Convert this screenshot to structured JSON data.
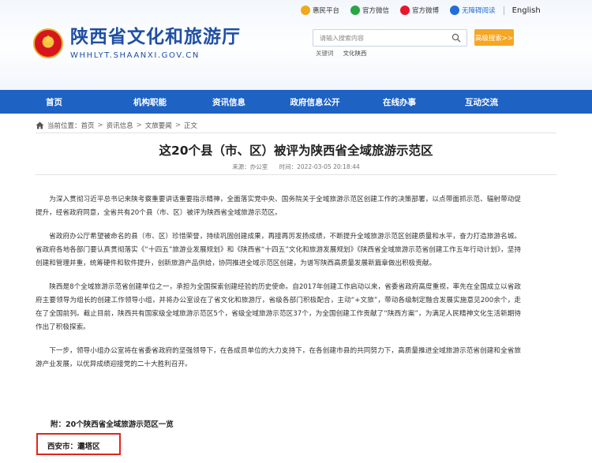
{
  "site": {
    "title": "陕西省文化和旅游厅",
    "domain": "WHHLYT.SHAANXI.GOV.CN"
  },
  "toplinks": [
    {
      "label": "惠民平台",
      "icon": "people-icon"
    },
    {
      "label": "官方微信",
      "icon": "wechat-icon"
    },
    {
      "label": "官方微博",
      "icon": "weibo-icon"
    },
    {
      "label": "无障碍阅读",
      "icon": "accessibility-icon"
    }
  ],
  "english_label": "English",
  "search": {
    "placeholder": "请输入搜索内容",
    "advanced_label": "高级搜索>>",
    "hot_label": "关键词",
    "hot_keyword": "文化陕西"
  },
  "nav": [
    "首页",
    "机构职能",
    "资讯信息",
    "政府信息公开",
    "在线办事",
    "互动交流"
  ],
  "breadcrumb": {
    "prefix": "当前位置：",
    "items": [
      "首页",
      "资讯信息",
      "文旅要闻",
      "正文"
    ]
  },
  "article": {
    "title": "这20个县（市、区）被评为陕西省全域旅游示范区",
    "source": "来源：办公室",
    "time": "时间：2022-03-05 20:18:44",
    "paragraphs": [
      "为深入贯彻习近平总书记来陕考察重要讲话重要指示精神，全面落实党中央、国务院关于全域旅游示范区创建工作的决策部署，以点带面抓示范、辐射带动促提升，经省政府同意，全省共有20个县（市、区）被评为陕西省全域旅游示范区。",
      "省政府办公厅希望被命名的县（市、区）珍惜荣誉，持续巩固创建成果，再接再厉发扬成绩，不断提升全域旅游示范区创建质量和水平，奋力打造旅游名城。省政府各地各部门要认真贯彻落实《“十四五”旅游业发展规划》和《陕西省“十四五”文化和旅游发展规划》《陕西省全域旅游示范省创建工作五年行动计划》，坚持创建和管理并重，统筹硬件和软件提升，创新旅游产品供给，协同推进全域示范区创建，为谱写陕西高质量发展新篇章做出积极贡献。",
      "陕西是8个全域旅游示范省创建单位之一，承担为全国探索创建经验的历史使命。自2017年创建工作启动以来，省委省政府高度重视，率先在全国成立以省政府主要领导为组长的创建工作领导小组，并将办公室设在了省文化和旅游厅，省级各部门积极配合，主动“+文旅”，带动各级制定融合发展实施意见200余个，走在了全国前列。截止目前，陕西共有国家级全域旅游示范区5个，省级全域旅游示范区37个，为全国创建工作贡献了“陕西方案”，为满足人民精神文化生活新期待作出了积极探索。",
      "下一步，领导小组办公室将在省委省政府的坚强领导下，在各成员单位的大力支持下，在各创建市县的共同努力下，高质量推进全域旅游示范省创建和全省旅游产业发展，以优异成绩迎接党的二十大胜利召开。"
    ],
    "appendix_title": "附：20个陕西省全域旅游示范区一览",
    "first_entry": "西安市：灞塔区"
  },
  "colors": {
    "nav_bg": "#1e62c4",
    "brand_blue": "#1f4fa3",
    "advanced_btn": "#f6a623",
    "highlight_box": "#e1251b"
  }
}
